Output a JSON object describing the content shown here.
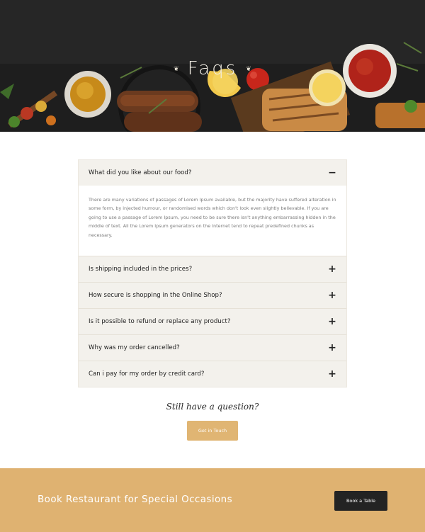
{
  "hero": {
    "title": "Faqs",
    "ornament_left": "❦",
    "ornament_right": "❦"
  },
  "faq": {
    "items": [
      {
        "question": "What did you like about our food?",
        "toggle": "−",
        "answer": "There are many variations of passages of Lorem Ipsum available, but the majority have suffered alteration in some form, by injected humour, or randomised words which don't look even slightly believable. If you are going to use a passage of Lorem Ipsum, you need to be sure there isn't anything embarrassing hidden in the middle of text. All the Lorem Ipsum generators on the Internet tend to repeat predefined chunks as necessary.",
        "open": true
      },
      {
        "question": "Is shipping included in the prices?",
        "toggle": "+",
        "open": false
      },
      {
        "question": "How secure is shopping in the Online Shop?",
        "toggle": "+",
        "open": false
      },
      {
        "question": "Is it possible to refund or replace any product?",
        "toggle": "+",
        "open": false
      },
      {
        "question": "Why was my order cancelled?",
        "toggle": "+",
        "open": false
      },
      {
        "question": "Can i pay for my order by credit card?",
        "toggle": "+",
        "open": false
      }
    ]
  },
  "contact": {
    "prompt": "Still have a question?",
    "button_label": "Get in Touch"
  },
  "banner": {
    "title": "Book Restaurant for Special Occasions",
    "button_label": "Book a Table"
  },
  "colors": {
    "accent": "#dfb271",
    "dark_button": "#232323",
    "faq_bg": "#f3f1ec"
  }
}
